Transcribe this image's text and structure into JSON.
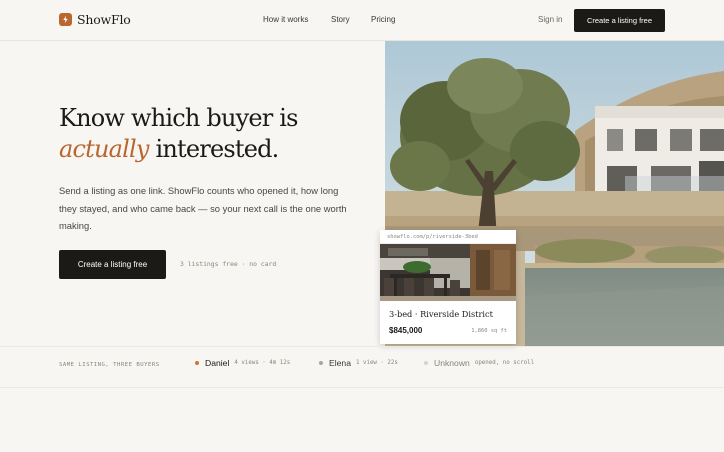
{
  "brand": {
    "name": "ShowFlo"
  },
  "nav": {
    "links": [
      "How it works",
      "Story",
      "Pricing"
    ],
    "signin_label": "Sign in",
    "cta_label": "Create a listing free"
  },
  "hero": {
    "title_line1": "Know which buyer is",
    "title_em": "actually",
    "title_rest": " interested.",
    "subtitle": "Send a listing as one link. ShowFlo counts who opened it, how long they stayed, and who came back — so your next call is the one worth making.",
    "cta_label": "Create a listing free",
    "note": "3 listings free · no card"
  },
  "listing_card": {
    "url": "showflo.com/p/riverside-3bed",
    "title": "3-bed · Riverside District",
    "price": "$845,000",
    "sqft": "1,860 sq ft"
  },
  "buyers_strip": {
    "label": "SAME LISTING, THREE BUYERS",
    "buyers": [
      {
        "name": "Daniel",
        "stats": "4 views · 4m 12s",
        "dot_color": "#c8763e",
        "name_color": "#1c1a17"
      },
      {
        "name": "Elena",
        "stats": "1 view · 22s",
        "dot_color": "#aaa59e",
        "name_color": "#3a3632"
      },
      {
        "name": "Unknown",
        "stats": "opened, no scroll",
        "dot_color": "#d6d2cb",
        "name_color": "#8a847c"
      }
    ]
  },
  "colors": {
    "accent": "#b9662f",
    "ink": "#1c1a17",
    "background": "#f8f6f3"
  },
  "icons": {
    "brand": "flame-icon"
  }
}
